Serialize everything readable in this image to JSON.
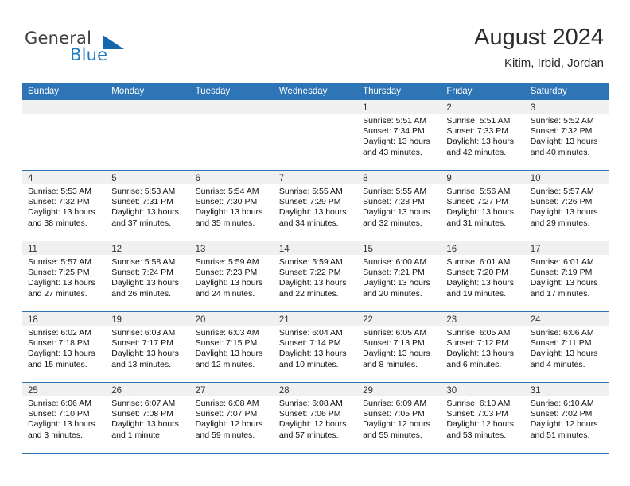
{
  "brand": {
    "name_top": "General",
    "name_bottom": "Blue",
    "triangle_color": "#1567ad",
    "blue_color": "#1f7ac0",
    "gray_color": "#3f3f3f"
  },
  "header": {
    "title": "August 2024",
    "location": "Kitim, Irbid, Jordan"
  },
  "theme": {
    "header_band": "#2e75b6",
    "day_band": "#f0f0f0",
    "grid_line": "#2e75b6"
  },
  "weekdays": [
    "Sunday",
    "Monday",
    "Tuesday",
    "Wednesday",
    "Thursday",
    "Friday",
    "Saturday"
  ],
  "weeks": [
    [
      {
        "day": "",
        "sunrise": "",
        "sunset": "",
        "daylight_line1": "",
        "daylight_line2": ""
      },
      {
        "day": "",
        "sunrise": "",
        "sunset": "",
        "daylight_line1": "",
        "daylight_line2": ""
      },
      {
        "day": "",
        "sunrise": "",
        "sunset": "",
        "daylight_line1": "",
        "daylight_line2": ""
      },
      {
        "day": "",
        "sunrise": "",
        "sunset": "",
        "daylight_line1": "",
        "daylight_line2": ""
      },
      {
        "day": "1",
        "sunrise": "Sunrise: 5:51 AM",
        "sunset": "Sunset: 7:34 PM",
        "daylight_line1": "Daylight: 13 hours",
        "daylight_line2": "and 43 minutes."
      },
      {
        "day": "2",
        "sunrise": "Sunrise: 5:51 AM",
        "sunset": "Sunset: 7:33 PM",
        "daylight_line1": "Daylight: 13 hours",
        "daylight_line2": "and 42 minutes."
      },
      {
        "day": "3",
        "sunrise": "Sunrise: 5:52 AM",
        "sunset": "Sunset: 7:32 PM",
        "daylight_line1": "Daylight: 13 hours",
        "daylight_line2": "and 40 minutes."
      }
    ],
    [
      {
        "day": "4",
        "sunrise": "Sunrise: 5:53 AM",
        "sunset": "Sunset: 7:32 PM",
        "daylight_line1": "Daylight: 13 hours",
        "daylight_line2": "and 38 minutes."
      },
      {
        "day": "5",
        "sunrise": "Sunrise: 5:53 AM",
        "sunset": "Sunset: 7:31 PM",
        "daylight_line1": "Daylight: 13 hours",
        "daylight_line2": "and 37 minutes."
      },
      {
        "day": "6",
        "sunrise": "Sunrise: 5:54 AM",
        "sunset": "Sunset: 7:30 PM",
        "daylight_line1": "Daylight: 13 hours",
        "daylight_line2": "and 35 minutes."
      },
      {
        "day": "7",
        "sunrise": "Sunrise: 5:55 AM",
        "sunset": "Sunset: 7:29 PM",
        "daylight_line1": "Daylight: 13 hours",
        "daylight_line2": "and 34 minutes."
      },
      {
        "day": "8",
        "sunrise": "Sunrise: 5:55 AM",
        "sunset": "Sunset: 7:28 PM",
        "daylight_line1": "Daylight: 13 hours",
        "daylight_line2": "and 32 minutes."
      },
      {
        "day": "9",
        "sunrise": "Sunrise: 5:56 AM",
        "sunset": "Sunset: 7:27 PM",
        "daylight_line1": "Daylight: 13 hours",
        "daylight_line2": "and 31 minutes."
      },
      {
        "day": "10",
        "sunrise": "Sunrise: 5:57 AM",
        "sunset": "Sunset: 7:26 PM",
        "daylight_line1": "Daylight: 13 hours",
        "daylight_line2": "and 29 minutes."
      }
    ],
    [
      {
        "day": "11",
        "sunrise": "Sunrise: 5:57 AM",
        "sunset": "Sunset: 7:25 PM",
        "daylight_line1": "Daylight: 13 hours",
        "daylight_line2": "and 27 minutes."
      },
      {
        "day": "12",
        "sunrise": "Sunrise: 5:58 AM",
        "sunset": "Sunset: 7:24 PM",
        "daylight_line1": "Daylight: 13 hours",
        "daylight_line2": "and 26 minutes."
      },
      {
        "day": "13",
        "sunrise": "Sunrise: 5:59 AM",
        "sunset": "Sunset: 7:23 PM",
        "daylight_line1": "Daylight: 13 hours",
        "daylight_line2": "and 24 minutes."
      },
      {
        "day": "14",
        "sunrise": "Sunrise: 5:59 AM",
        "sunset": "Sunset: 7:22 PM",
        "daylight_line1": "Daylight: 13 hours",
        "daylight_line2": "and 22 minutes."
      },
      {
        "day": "15",
        "sunrise": "Sunrise: 6:00 AM",
        "sunset": "Sunset: 7:21 PM",
        "daylight_line1": "Daylight: 13 hours",
        "daylight_line2": "and 20 minutes."
      },
      {
        "day": "16",
        "sunrise": "Sunrise: 6:01 AM",
        "sunset": "Sunset: 7:20 PM",
        "daylight_line1": "Daylight: 13 hours",
        "daylight_line2": "and 19 minutes."
      },
      {
        "day": "17",
        "sunrise": "Sunrise: 6:01 AM",
        "sunset": "Sunset: 7:19 PM",
        "daylight_line1": "Daylight: 13 hours",
        "daylight_line2": "and 17 minutes."
      }
    ],
    [
      {
        "day": "18",
        "sunrise": "Sunrise: 6:02 AM",
        "sunset": "Sunset: 7:18 PM",
        "daylight_line1": "Daylight: 13 hours",
        "daylight_line2": "and 15 minutes."
      },
      {
        "day": "19",
        "sunrise": "Sunrise: 6:03 AM",
        "sunset": "Sunset: 7:17 PM",
        "daylight_line1": "Daylight: 13 hours",
        "daylight_line2": "and 13 minutes."
      },
      {
        "day": "20",
        "sunrise": "Sunrise: 6:03 AM",
        "sunset": "Sunset: 7:15 PM",
        "daylight_line1": "Daylight: 13 hours",
        "daylight_line2": "and 12 minutes."
      },
      {
        "day": "21",
        "sunrise": "Sunrise: 6:04 AM",
        "sunset": "Sunset: 7:14 PM",
        "daylight_line1": "Daylight: 13 hours",
        "daylight_line2": "and 10 minutes."
      },
      {
        "day": "22",
        "sunrise": "Sunrise: 6:05 AM",
        "sunset": "Sunset: 7:13 PM",
        "daylight_line1": "Daylight: 13 hours",
        "daylight_line2": "and 8 minutes."
      },
      {
        "day": "23",
        "sunrise": "Sunrise: 6:05 AM",
        "sunset": "Sunset: 7:12 PM",
        "daylight_line1": "Daylight: 13 hours",
        "daylight_line2": "and 6 minutes."
      },
      {
        "day": "24",
        "sunrise": "Sunrise: 6:06 AM",
        "sunset": "Sunset: 7:11 PM",
        "daylight_line1": "Daylight: 13 hours",
        "daylight_line2": "and 4 minutes."
      }
    ],
    [
      {
        "day": "25",
        "sunrise": "Sunrise: 6:06 AM",
        "sunset": "Sunset: 7:10 PM",
        "daylight_line1": "Daylight: 13 hours",
        "daylight_line2": "and 3 minutes."
      },
      {
        "day": "26",
        "sunrise": "Sunrise: 6:07 AM",
        "sunset": "Sunset: 7:08 PM",
        "daylight_line1": "Daylight: 13 hours",
        "daylight_line2": "and 1 minute."
      },
      {
        "day": "27",
        "sunrise": "Sunrise: 6:08 AM",
        "sunset": "Sunset: 7:07 PM",
        "daylight_line1": "Daylight: 12 hours",
        "daylight_line2": "and 59 minutes."
      },
      {
        "day": "28",
        "sunrise": "Sunrise: 6:08 AM",
        "sunset": "Sunset: 7:06 PM",
        "daylight_line1": "Daylight: 12 hours",
        "daylight_line2": "and 57 minutes."
      },
      {
        "day": "29",
        "sunrise": "Sunrise: 6:09 AM",
        "sunset": "Sunset: 7:05 PM",
        "daylight_line1": "Daylight: 12 hours",
        "daylight_line2": "and 55 minutes."
      },
      {
        "day": "30",
        "sunrise": "Sunrise: 6:10 AM",
        "sunset": "Sunset: 7:03 PM",
        "daylight_line1": "Daylight: 12 hours",
        "daylight_line2": "and 53 minutes."
      },
      {
        "day": "31",
        "sunrise": "Sunrise: 6:10 AM",
        "sunset": "Sunset: 7:02 PM",
        "daylight_line1": "Daylight: 12 hours",
        "daylight_line2": "and 51 minutes."
      }
    ]
  ]
}
